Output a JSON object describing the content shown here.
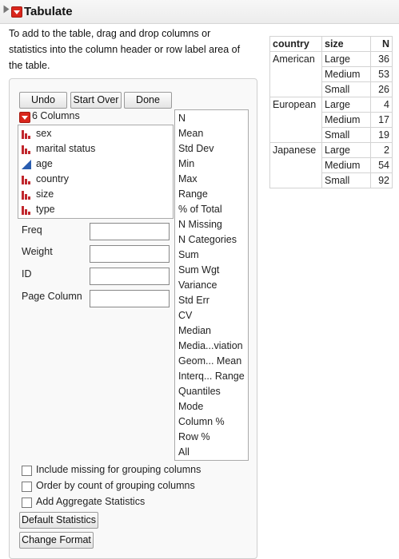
{
  "header": {
    "title": "Tabulate"
  },
  "instructions": "To add to the table, drag and drop columns or statistics into the column header or row label area of the table.",
  "buttons": {
    "undo": "Undo",
    "start_over": "Start Over",
    "done": "Done",
    "default_statistics": "Default Statistics",
    "change_format": "Change Format"
  },
  "columns": {
    "header": "6 Columns",
    "items": [
      {
        "label": "sex",
        "icon": "nominal-bar-icon",
        "color": "#c1272d"
      },
      {
        "label": "marital status",
        "icon": "nominal-bar-icon",
        "color": "#c1272d"
      },
      {
        "label": "age",
        "icon": "continuous-triangle-icon",
        "color": "#2a5db0"
      },
      {
        "label": "country",
        "icon": "nominal-bar-icon",
        "color": "#c1272d"
      },
      {
        "label": "size",
        "icon": "nominal-bar-icon",
        "color": "#c1272d"
      },
      {
        "label": "type",
        "icon": "nominal-bar-icon",
        "color": "#c1272d"
      }
    ]
  },
  "fields": {
    "freq": "Freq",
    "weight": "Weight",
    "id": "ID",
    "page_column": "Page Column"
  },
  "statistics": [
    "N",
    "Mean",
    "Std Dev",
    "Min",
    "Max",
    "Range",
    "% of Total",
    "N Missing",
    "N Categories",
    "Sum",
    "Sum Wgt",
    "Variance",
    "Std Err",
    "CV",
    "Median",
    "Media...viation",
    "Geom... Mean",
    "Interq... Range",
    "Quantiles",
    "Mode",
    "Column %",
    "Row %",
    "All"
  ],
  "checkboxes": {
    "include_missing": "Include missing for grouping columns",
    "order_by_count": "Order by count of grouping columns",
    "add_aggregate": "Add Aggregate Statistics"
  },
  "table": {
    "headers": [
      "country",
      "size",
      "N"
    ],
    "groups": [
      {
        "country": "American",
        "rows": [
          {
            "size": "Large",
            "n": "36"
          },
          {
            "size": "Medium",
            "n": "53"
          },
          {
            "size": "Small",
            "n": "26"
          }
        ]
      },
      {
        "country": "European",
        "rows": [
          {
            "size": "Large",
            "n": "4"
          },
          {
            "size": "Medium",
            "n": "17"
          },
          {
            "size": "Small",
            "n": "19"
          }
        ]
      },
      {
        "country": "Japanese",
        "rows": [
          {
            "size": "Large",
            "n": "2"
          },
          {
            "size": "Medium",
            "n": "54"
          },
          {
            "size": "Small",
            "n": "92"
          }
        ]
      }
    ]
  }
}
